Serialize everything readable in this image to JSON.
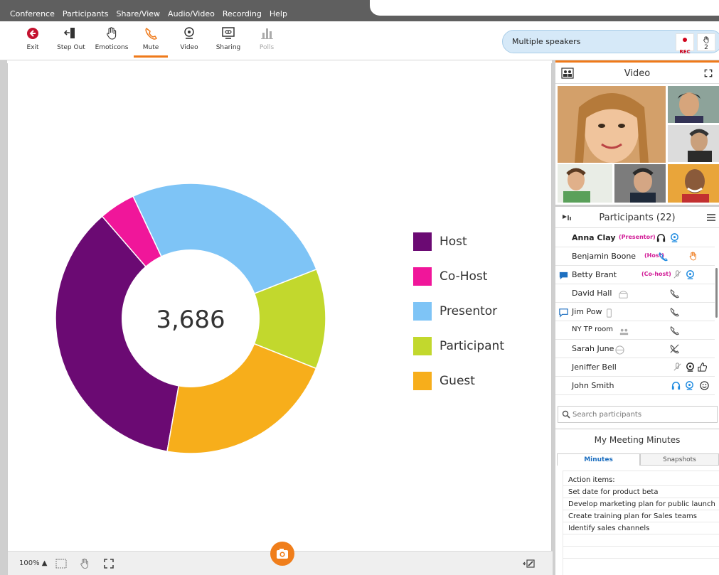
{
  "menu": [
    "Conference",
    "Participants",
    "Share/View",
    "Audio/Video",
    "Recording",
    "Help"
  ],
  "toolbar": {
    "exit": "Exit",
    "stepout": "Step Out",
    "emoticons": "Emoticons",
    "mute": "Mute",
    "video": "Video",
    "sharing": "Sharing",
    "polls": "Polls"
  },
  "speakers": {
    "label": "Multiple speakers",
    "rec": "REC",
    "hands": "2"
  },
  "colors": {
    "host": "#6b0a73",
    "cohost": "#f0169a",
    "presentor": "#7ec4f6",
    "participant": "#c2d82d",
    "guest": "#f7ae1b",
    "accent": "#ef7a1a"
  },
  "chart_data": {
    "type": "pie",
    "variant": "donut",
    "center_label": "3,686",
    "categories": [
      "Host",
      "Co-Host",
      "Presentor",
      "Participant",
      "Guest"
    ],
    "values": [
      33,
      4,
      24,
      11,
      20
    ],
    "legend": [
      "Host",
      "Co-Host",
      "Presentor",
      "Participant",
      "Guest"
    ]
  },
  "bottombar": {
    "zoom": "100% ▲"
  },
  "video": {
    "title": "Video"
  },
  "participants": {
    "title": "Participants (22)",
    "search_placeholder": "Search participants",
    "rows": [
      {
        "name": "Anna Clay",
        "role": "(Presentor)"
      },
      {
        "name": "Benjamin Boone",
        "role": "(Host)"
      },
      {
        "name": "Betty Brant",
        "role": "(Co-host)"
      },
      {
        "name": "David Hall",
        "role": ""
      },
      {
        "name": "Jim Pow",
        "role": ""
      },
      {
        "name": "NY TP room",
        "role": ""
      },
      {
        "name": "Sarah June",
        "role": ""
      },
      {
        "name": "Jeniffer Bell",
        "role": ""
      },
      {
        "name": "John Smith",
        "role": ""
      }
    ]
  },
  "minutes": {
    "title": "My Meeting Minutes",
    "tabs": [
      "Minutes",
      "Snapshots"
    ],
    "lines": [
      "Action items:",
      "Set date for product beta",
      "Develop marketing plan for public launch",
      "Create training plan for Sales teams",
      "Identify sales channels"
    ]
  }
}
